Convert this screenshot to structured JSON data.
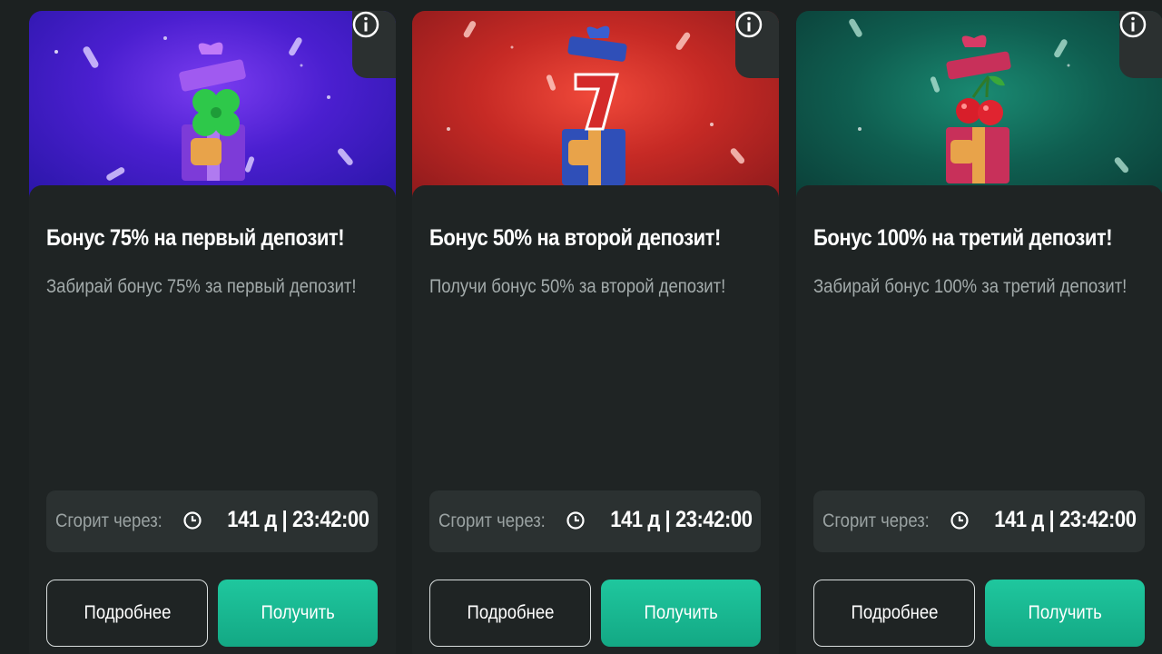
{
  "cards": [
    {
      "title": "Бонус 75% на первый депозит!",
      "description": "Забирай бонус 75% за первый депозит!",
      "expires_label": "Сгорит через:",
      "expires_value": "141 д | 23:42:00",
      "details_label": "Подробнее",
      "claim_label": "Получить",
      "banner_icon": "gift-box-clover-icon"
    },
    {
      "title": "Бонус 50% на второй депозит!",
      "description": "Получи бонус 50% за второй депозит!",
      "expires_label": "Сгорит через:",
      "expires_value": "141 д | 23:42:00",
      "details_label": "Подробнее",
      "claim_label": "Получить",
      "banner_icon": "gift-box-seven-icon"
    },
    {
      "title": "Бонус 100% на третий депозит!",
      "description": "Забирай бонус 100% за третий депозит!",
      "expires_label": "Сгорит через:",
      "expires_value": "141 д | 23:42:00",
      "details_label": "Подробнее",
      "claim_label": "Получить",
      "banner_icon": "gift-box-cherries-icon"
    }
  ],
  "colors": {
    "background": "#1c2121",
    "card": "#1f2424",
    "timer_box": "#2b3131",
    "accent": "#1fc79e",
    "banner_1": "#4b1fd0",
    "banner_2": "#c62a25",
    "banner_3": "#0f5e50"
  }
}
